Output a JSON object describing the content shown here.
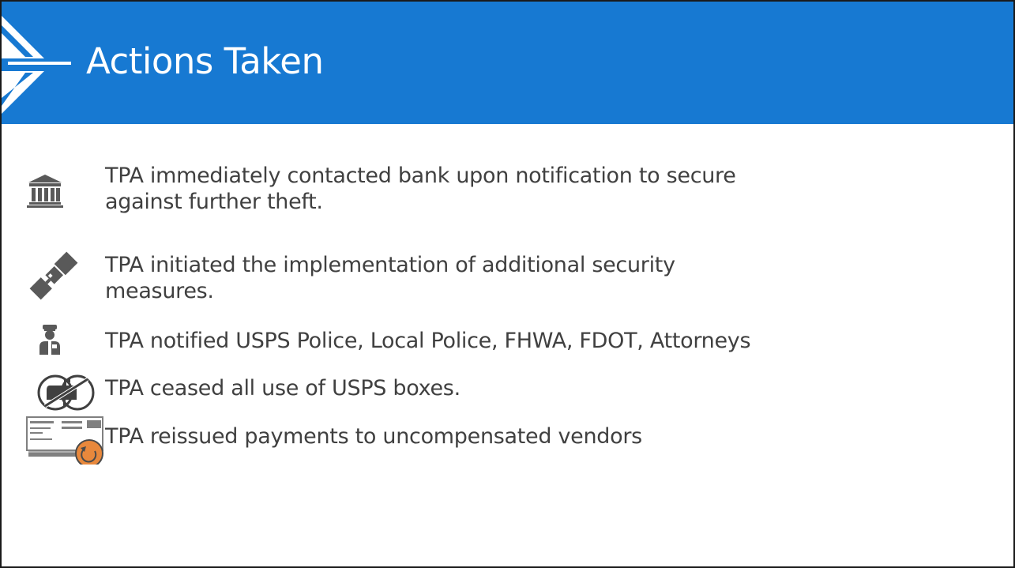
{
  "slide": {
    "title": "Actions Taken",
    "accent_color": "#1779d2",
    "text_color": "#404040",
    "icon_color": "#595959",
    "check_accent_color": "#e8883c"
  },
  "items": [
    {
      "icon": "bank-icon",
      "line1": "TPA immediately contacted bank upon notification to secure",
      "line2": "against further theft."
    },
    {
      "icon": "satellite-icon",
      "line1": "TPA initiated the implementation of additional security",
      "line2": "measures."
    },
    {
      "icon": "police-officer-icon",
      "line1": "TPA notified USPS Police, Local Police, FHWA, FDOT, Attorneys",
      "line2": ""
    },
    {
      "icon": "no-mailbox-icon",
      "line1": "TPA ceased all use of USPS boxes.",
      "line2": ""
    },
    {
      "icon": "check-reissue-icon",
      "line1": "TPA reissued payments to uncompensated vendors",
      "line2": ""
    }
  ]
}
